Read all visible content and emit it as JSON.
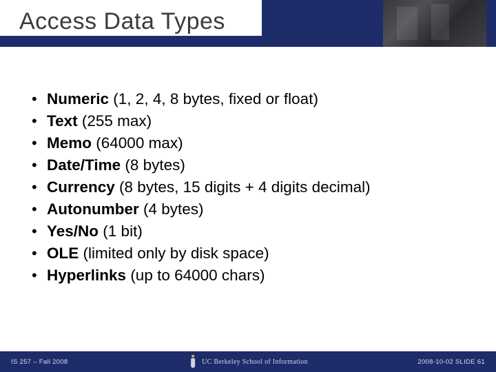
{
  "title": "Access Data Types",
  "bullets": [
    {
      "term": "Numeric",
      "desc": " (1, 2, 4, 8 bytes, fixed or float)"
    },
    {
      "term": "Text",
      "desc": " (255 max)"
    },
    {
      "term": "Memo",
      "desc": " (64000 max)"
    },
    {
      "term": "Date/Time",
      "desc": " (8 bytes)"
    },
    {
      "term": "Currency",
      "desc": " (8 bytes, 15 digits + 4 digits decimal)"
    },
    {
      "term": "Autonumber",
      "desc": " (4 bytes)"
    },
    {
      "term": "Yes/No",
      "desc": " (1 bit)"
    },
    {
      "term": "OLE",
      "desc": " (limited only by disk space)"
    },
    {
      "term": "Hyperlinks",
      "desc": " (up to 64000 chars)"
    }
  ],
  "footer": {
    "left": "IS 257 – Fall 2008",
    "center": "UC Berkeley School of Information",
    "right": "2008-10-02  SLIDE 61"
  }
}
